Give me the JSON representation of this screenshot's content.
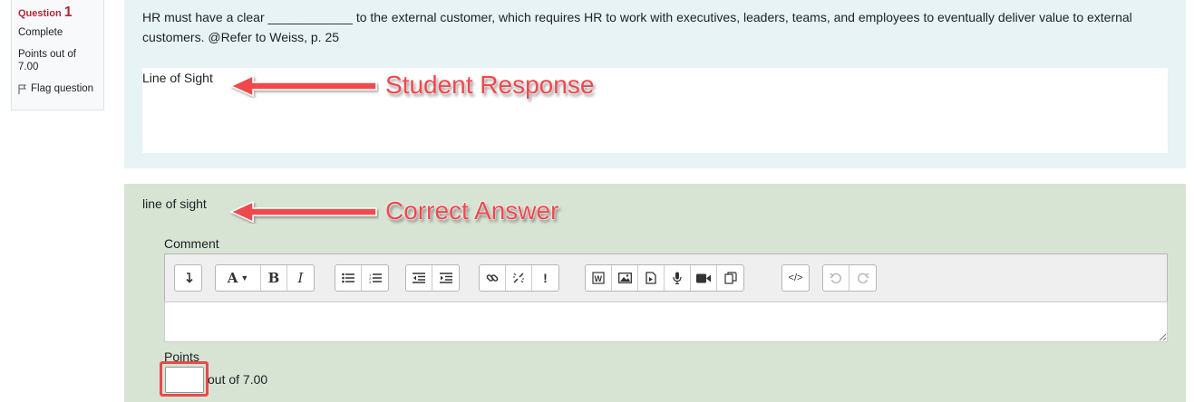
{
  "question_info": {
    "label": "Question",
    "number": "1",
    "state": "Complete",
    "grade": "Points out of 7.00",
    "flag_label": "Flag question"
  },
  "question": {
    "text": "HR must have a clear ____________ to the external customer, which requires HR to work with executives, leaders, teams, and employees to eventually deliver value to external customers. @Refer to Weiss, p. 25",
    "student_response": "Line of Sight"
  },
  "outcome": {
    "right_answer": "line of sight",
    "comment_label": "Comment",
    "points_label": "Points",
    "points_value": "",
    "out_of": "out of 7.00"
  },
  "annotations": {
    "student_response": "Student Response",
    "correct_answer": "Correct Answer",
    "color": "#f0484d"
  },
  "toolbar": {
    "groups": [
      [
        "collapse-icon"
      ],
      [
        "font-color-icon",
        "bold-icon",
        "italic-icon"
      ],
      [
        "unordered-list-icon",
        "ordered-list-icon"
      ],
      [
        "outdent-icon",
        "indent-icon"
      ],
      [
        "link-icon",
        "unlink-icon",
        "emoji-icon"
      ],
      [
        "word-paste-icon",
        "image-icon",
        "media-icon",
        "record-audio-icon",
        "record-video-icon",
        "manage-files-icon"
      ],
      [
        "html-icon"
      ],
      [
        "undo-icon",
        "redo-icon"
      ]
    ]
  }
}
